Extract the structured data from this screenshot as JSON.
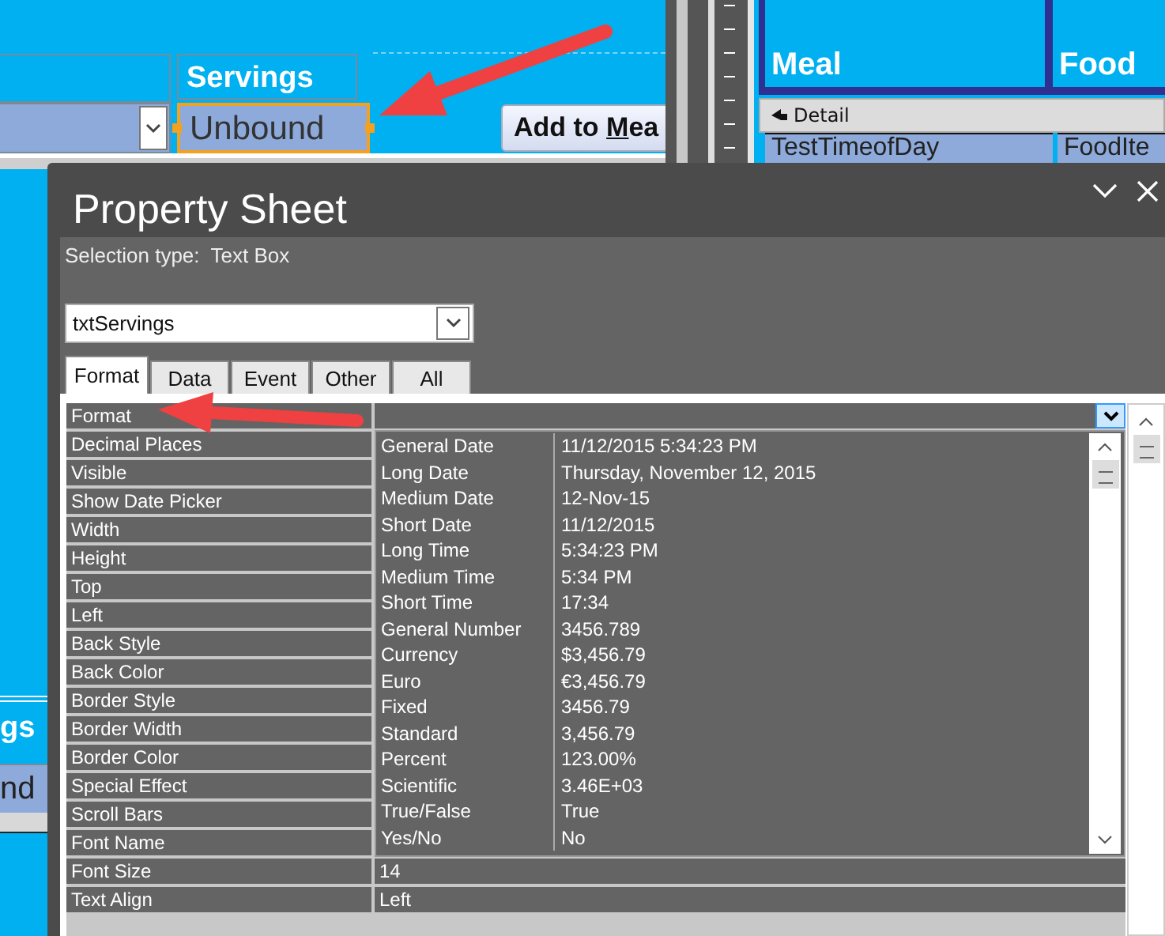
{
  "form_design": {
    "servings_label": "Servings",
    "servings_textbox": {
      "value": "Unbound",
      "selected": true
    },
    "add_button": {
      "before": "Add to ",
      "access_key": "M",
      "after": "ea"
    },
    "side_label": "gs",
    "side_textbox": "nd"
  },
  "report_design": {
    "headers": [
      "Meal",
      "Food"
    ],
    "section": "Detail",
    "fields": [
      "TestTimeofDay",
      "FoodIte"
    ]
  },
  "property_sheet": {
    "title": "Property Sheet",
    "selection_type_label": "Selection type:",
    "selection_type": "Text Box",
    "object": "txtServings",
    "tabs": [
      {
        "label": "Format",
        "selected": true
      },
      {
        "label": "Data",
        "selected": false
      },
      {
        "label": "Event",
        "selected": false
      },
      {
        "label": "Other",
        "selected": false
      },
      {
        "label": "All",
        "selected": false
      }
    ],
    "properties": [
      {
        "label": "Format",
        "kind": "dropdown",
        "expanded": true
      },
      {
        "label": "Decimal Places"
      },
      {
        "label": "Visible"
      },
      {
        "label": "Show Date Picker"
      },
      {
        "label": "Width"
      },
      {
        "label": "Height"
      },
      {
        "label": "Top"
      },
      {
        "label": "Left"
      },
      {
        "label": "Back Style"
      },
      {
        "label": "Back Color"
      },
      {
        "label": "Border Style"
      },
      {
        "label": "Border Width"
      },
      {
        "label": "Border Color"
      },
      {
        "label": "Special Effect"
      },
      {
        "label": "Scroll Bars"
      },
      {
        "label": "Font Name"
      },
      {
        "label": "Font Size",
        "value": "14"
      },
      {
        "label": "Text Align",
        "value": "Left"
      }
    ],
    "format_options": [
      {
        "name": "General Date",
        "example": "11/12/2015 5:34:23 PM"
      },
      {
        "name": "Long Date",
        "example": "Thursday, November 12, 2015"
      },
      {
        "name": "Medium Date",
        "example": "12-Nov-15"
      },
      {
        "name": "Short Date",
        "example": "11/12/2015"
      },
      {
        "name": "Long Time",
        "example": "5:34:23 PM"
      },
      {
        "name": "Medium Time",
        "example": "5:34 PM"
      },
      {
        "name": "Short Time",
        "example": "17:34"
      },
      {
        "name": "General Number",
        "example": "3456.789"
      },
      {
        "name": "Currency",
        "example": "$3,456.79"
      },
      {
        "name": "Euro",
        "example": "€3,456.79"
      },
      {
        "name": "Fixed",
        "example": "3456.79"
      },
      {
        "name": "Standard",
        "example": "3,456.79"
      },
      {
        "name": "Percent",
        "example": "123.00%"
      },
      {
        "name": "Scientific",
        "example": "3.46E+03"
      },
      {
        "name": "True/False",
        "example": "True"
      },
      {
        "name": "Yes/No",
        "example": "No"
      }
    ]
  }
}
